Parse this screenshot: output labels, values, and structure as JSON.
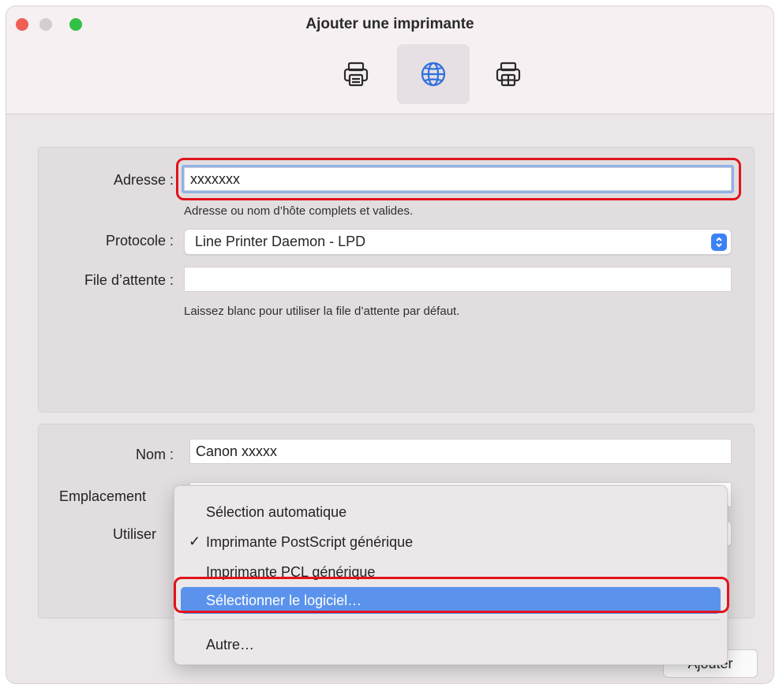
{
  "window": {
    "title": "Ajouter une imprimante"
  },
  "toolbar": {
    "buttons": [
      {
        "icon": "printer-icon",
        "selected": false
      },
      {
        "icon": "globe-icon",
        "selected": true
      },
      {
        "icon": "windows-printer-icon",
        "selected": false
      }
    ]
  },
  "form": {
    "address": {
      "label": "Adresse :",
      "value": "xxxxxxx",
      "hint": "Adresse ou nom d’hôte complets et valides."
    },
    "protocol": {
      "label": "Protocole :",
      "value": "Line Printer Daemon - LPD"
    },
    "queue": {
      "label": "File d’attente :",
      "value": "",
      "hint": "Laissez blanc pour utiliser la file d’attente par défaut."
    },
    "name": {
      "label": "Nom :",
      "value": "Canon xxxxx"
    },
    "location": {
      "label": "Emplacement",
      "value": ""
    },
    "use": {
      "label": "Utiliser",
      "value": ""
    }
  },
  "menu": {
    "items": [
      {
        "label": "Sélection automatique",
        "checked": false,
        "selected": false
      },
      {
        "label": "Imprimante PostScript générique",
        "checked": true,
        "selected": false
      },
      {
        "label": "Imprimante PCL générique",
        "checked": false,
        "selected": false
      },
      {
        "label": "Sélectionner le logiciel…",
        "checked": false,
        "selected": true
      },
      {
        "label": "Autre…",
        "checked": false,
        "selected": false
      }
    ],
    "check_glyph": "✓"
  },
  "add_button": {
    "label": "Ajouter"
  },
  "colors": {
    "accent": "#3b82f6",
    "menu_highlight": "#5b93ec",
    "annotation_red": "#e0141c"
  }
}
